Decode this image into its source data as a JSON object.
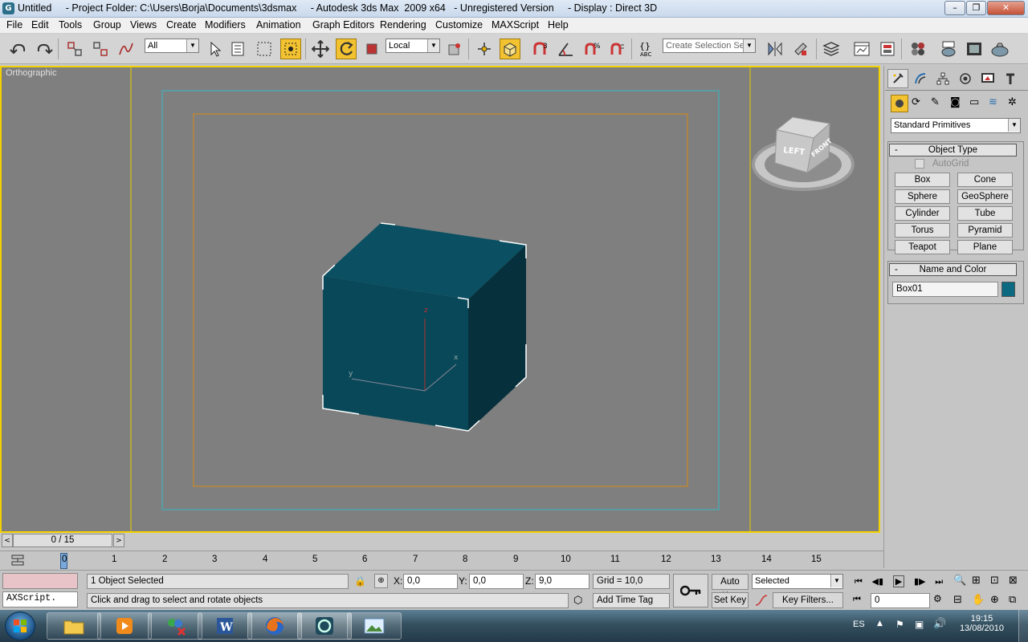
{
  "window": {
    "title": "Untitled     - Project Folder: C:\\Users\\Borja\\Documents\\3dsmax     - Autodesk 3ds Max  2009 x64   - Unregistered Version     - Display : Direct 3D",
    "buttons": [
      "–",
      "❐",
      "✕"
    ]
  },
  "menu": [
    "File",
    "Edit",
    "Tools",
    "Group",
    "Views",
    "Create",
    "Modifiers",
    "Animation",
    "Graph Editors",
    "Rendering",
    "Customize",
    "MAXScript",
    "Help"
  ],
  "toolbar": {
    "filter_value": "All",
    "coord_system": "Local",
    "selection_set_placeholder": "Create Selection Set"
  },
  "viewport": {
    "label": "Orthographic",
    "axis_labels": {
      "z": "z",
      "x": "x",
      "y": "y"
    },
    "viewcube": {
      "left": "LEFT",
      "front": "FRONT"
    },
    "object_color": "#0b5468"
  },
  "command_panel": {
    "category": "Standard Primitives",
    "object_type_title": "Object Type",
    "autogrid": "AutoGrid",
    "primitives": [
      "Box",
      "Cone",
      "Sphere",
      "GeoSphere",
      "Cylinder",
      "Tube",
      "Torus",
      "Pyramid",
      "Teapot",
      "Plane"
    ],
    "name_color_title": "Name and Color",
    "object_name": "Box01",
    "object_color": "#0b6a80"
  },
  "timeline": {
    "frame_counter": "0 / 15",
    "ticks": [
      "0",
      "1",
      "2",
      "3",
      "4",
      "5",
      "6",
      "7",
      "8",
      "9",
      "10",
      "11",
      "12",
      "13",
      "14",
      "15"
    ],
    "current_frame": 0,
    "total_frames": 15
  },
  "status": {
    "maxscript": "AXScript.",
    "selection_info": "1 Object Selected",
    "prompt": "Click and drag to select and rotate objects",
    "x_label": "X:",
    "x_value": "0,0",
    "y_label": "Y:",
    "y_value": "0,0",
    "z_label": "Z:",
    "z_value": "9,0",
    "grid": "Grid = 10,0",
    "add_time_tag": "Add Time Tag",
    "auto_key": "Auto Key",
    "set_key": "Set Key",
    "key_mode": "Selected",
    "key_filters": "Key Filters...",
    "frame_value": "0"
  },
  "taskbar": {
    "language": "ES",
    "time": "19:15",
    "date": "13/08/2010"
  }
}
